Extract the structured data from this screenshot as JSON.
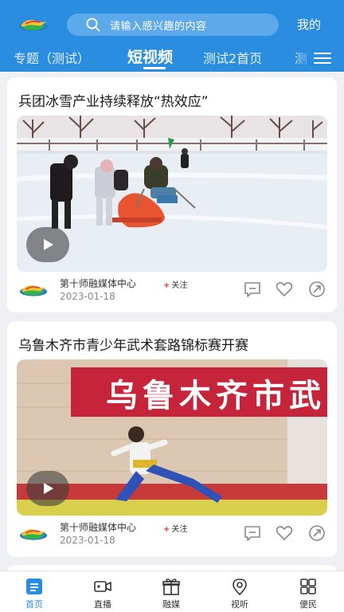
{
  "header": {
    "search_placeholder": "请输入感兴趣的内容",
    "mine_label": "我的"
  },
  "tabs": [
    {
      "label": "专题（测试）",
      "active": false
    },
    {
      "label": "短视频",
      "active": true
    },
    {
      "label": "测试2首页",
      "active": false
    },
    {
      "label": "测",
      "active": false
    }
  ],
  "feed": [
    {
      "title": "兵团冰雪产业持续释放“热效应”",
      "source": "第十师融媒体中心",
      "follow_label": "关注",
      "date": "2023-01-18"
    },
    {
      "title": "乌鲁木齐市青少年武术套路锦标赛开赛",
      "source": "第十师融媒体中心",
      "follow_label": "关注",
      "date": "2023-01-18",
      "banner_text": "乌鲁木齐市武"
    }
  ],
  "bottom_nav": [
    {
      "label": "首页",
      "icon": "home-icon",
      "active": true
    },
    {
      "label": "直播",
      "icon": "live-camera-icon",
      "active": false
    },
    {
      "label": "融媒",
      "icon": "gift-icon",
      "active": false
    },
    {
      "label": "视听",
      "icon": "location-pin-icon",
      "active": false
    },
    {
      "label": "便民",
      "icon": "grid-icon",
      "active": false
    }
  ],
  "colors": {
    "primary": "#2a8de0",
    "follow_plus": "#e23030",
    "banner_red": "#c5243a"
  }
}
